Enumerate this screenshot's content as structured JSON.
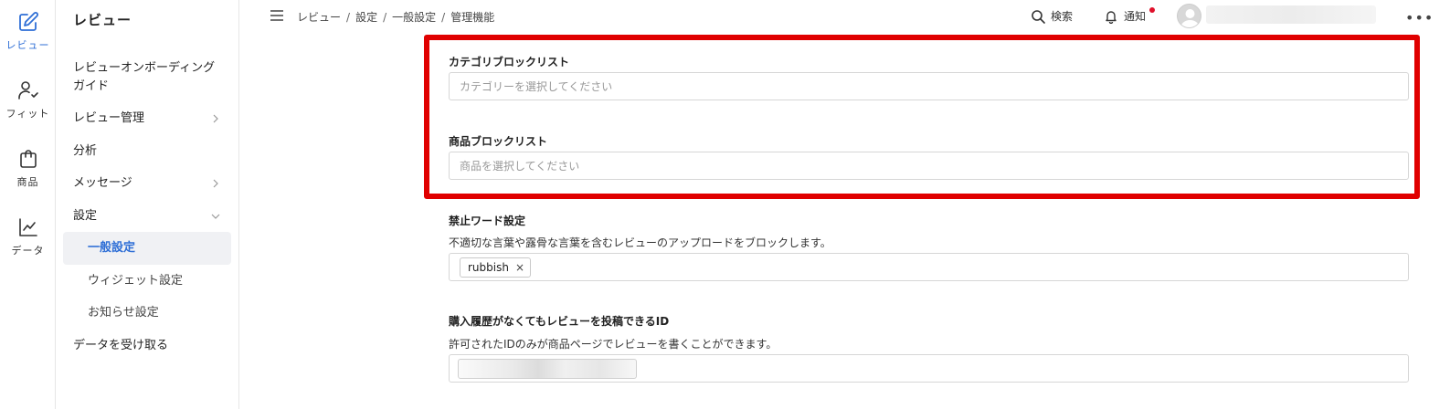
{
  "rail": {
    "items": [
      {
        "label": "レビュー",
        "icon": "edit-icon"
      },
      {
        "label": "フィット",
        "icon": "user-check-icon"
      },
      {
        "label": "商品",
        "icon": "shopping-bag-icon"
      },
      {
        "label": "データ",
        "icon": "line-chart-icon"
      }
    ]
  },
  "sidebar": {
    "title": "レビュー",
    "items": [
      {
        "label": "レビューオンボーディングガイド"
      },
      {
        "label": "レビュー管理"
      },
      {
        "label": "分析"
      },
      {
        "label": "メッセージ"
      },
      {
        "label": "設定"
      },
      {
        "label": "一般設定"
      },
      {
        "label": "ウィジェット設定"
      },
      {
        "label": "お知らせ設定"
      },
      {
        "label": "データを受け取る"
      }
    ]
  },
  "breadcrumb": {
    "items": [
      "レビュー",
      "設定",
      "一般設定",
      "管理機能"
    ],
    "separator": "/"
  },
  "topbar": {
    "search_label": "検索",
    "notify_label": "通知",
    "more_label": "•••"
  },
  "form": {
    "category_block": {
      "label": "カテゴリブロックリスト",
      "placeholder": "カテゴリーを選択してください"
    },
    "product_block": {
      "label": "商品ブロックリスト",
      "placeholder": "商品を選択してください"
    },
    "banned_words": {
      "label": "禁止ワード設定",
      "description": "不適切な言葉や露骨な言葉を含むレビューのアップロードをブロックします。",
      "tags": [
        "rubbish"
      ],
      "tag_close": "×"
    },
    "allowed_ids": {
      "label": "購入履歴がなくてもレビューを投稿できるID",
      "description": "許可されたIDのみが商品ページでレビューを書くことができます。"
    }
  },
  "colors": {
    "accent": "#2f6fd6",
    "highlight": "#e00000",
    "notification_dot": "#e0102a"
  }
}
